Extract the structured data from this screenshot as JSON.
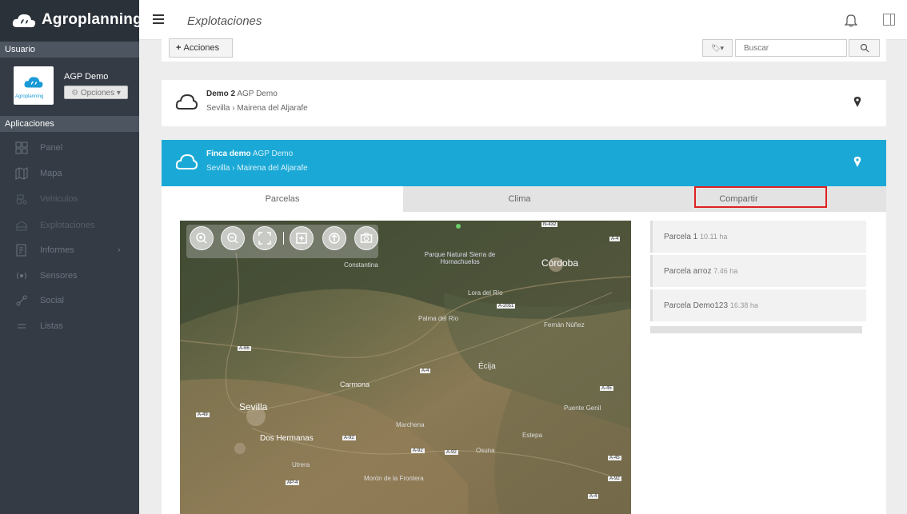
{
  "app": {
    "brand": "Agroplanning"
  },
  "sidebar": {
    "user_header": "Usuario",
    "user_name": "AGP Demo",
    "avatar_caption": "Agroplanning",
    "options_label": "Opciones ▾",
    "apps_header": "Aplicaciones",
    "items": [
      {
        "label": "Panel",
        "icon": "dashboard-icon"
      },
      {
        "label": "Mapa",
        "icon": "map-icon"
      },
      {
        "label": "Vehiculos",
        "icon": "vehicles-icon"
      },
      {
        "label": "Explotaciones",
        "icon": "farm-icon"
      },
      {
        "label": "Informes",
        "icon": "reports-icon"
      },
      {
        "label": "Sensores",
        "icon": "sensors-icon"
      },
      {
        "label": "Social",
        "icon": "social-icon"
      },
      {
        "label": "Listas",
        "icon": "list-icon"
      }
    ]
  },
  "topbar": {
    "title": "Explotaciones"
  },
  "toolbar": {
    "actions_label": "Acciones",
    "search_placeholder": "Buscar"
  },
  "farms": [
    {
      "name": "Demo 2",
      "owner": "AGP Demo",
      "location": "Sevilla › Mairena del Aljarafe"
    },
    {
      "name": "Finca demo",
      "owner": "AGP Demo",
      "location": "Sevilla › Mairena del Aljarafe"
    }
  ],
  "tabs": [
    {
      "label": "Parcelas"
    },
    {
      "label": "Clima"
    },
    {
      "label": "Compartir"
    }
  ],
  "map_labels": {
    "park": "Parque Natural Sierra de Hornachuelos",
    "cordoba": "Córdoba",
    "sevilla": "Sevilla",
    "dos_hermanas": "Dos Hermanas",
    "carmona": "Carmona",
    "constantina": "Constantina",
    "palma": "Palma del Río",
    "fernan": "Fernán Núñez",
    "ecija": "Écija",
    "marchena": "Marchena",
    "estepa": "Estepa",
    "puente_genil": "Puente Genil",
    "moron": "Morón de la Frontera",
    "utrera": "Utrera",
    "lora": "Lora del Río",
    "osuna": "Osuna"
  },
  "roads": [
    "N-432",
    "A-4",
    "A-2051",
    "A-66",
    "A-4",
    "A-49",
    "A-92",
    "A-92",
    "A-92",
    "A-45",
    "A-45",
    "A-92",
    "AP-4",
    "A-4"
  ],
  "parcels": [
    {
      "name": "Parcela 1",
      "area": "10.11 ha"
    },
    {
      "name": "Parcela arroz",
      "area": "7.46 ha"
    },
    {
      "name": "Parcela Demo123",
      "area": "16.38 ha"
    }
  ],
  "colors": {
    "sidebar": "#343b45",
    "accent": "#1aa9d6",
    "highlight": "#e02020"
  }
}
